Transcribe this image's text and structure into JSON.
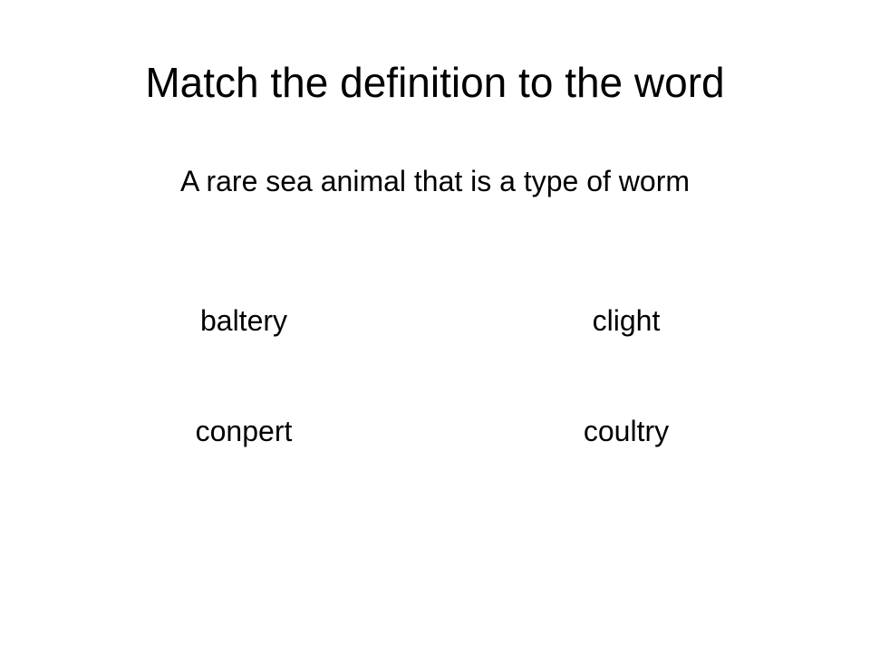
{
  "slide": {
    "title": "Match the definition to the word",
    "definition": "A rare sea animal that is a type of worm",
    "options": [
      "baltery",
      "clight",
      "conpert",
      "coultry"
    ]
  }
}
